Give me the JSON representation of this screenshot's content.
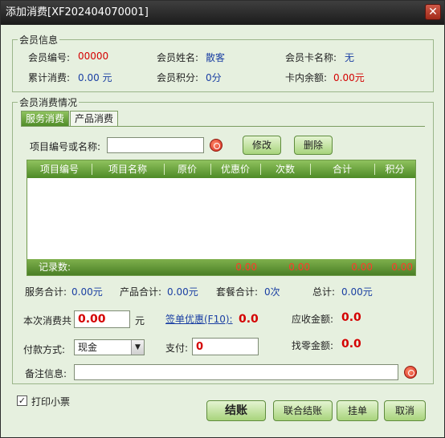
{
  "window": {
    "title": "添加消费[XF202404070001]",
    "close_glyph": "✕"
  },
  "member_info": {
    "title": "会员信息",
    "member_no_label": "会员编号:",
    "member_no_value": "00000",
    "member_name_label": "会员姓名:",
    "member_name_value": "散客",
    "card_name_label": "会员卡名称:",
    "card_name_value": "无",
    "total_spend_label": "累计消费:",
    "total_spend_value": "0.00 元",
    "points_label": "会员积分:",
    "points_value": "0分",
    "balance_label": "卡内余额:",
    "balance_value": "0.00元"
  },
  "consumption": {
    "title": "会员消费情况",
    "tabs": [
      {
        "label": "服务消费"
      },
      {
        "label": "产品消费"
      }
    ],
    "item_search_label": "项目编号或名称:",
    "item_search_value": "",
    "modify_label": "修改",
    "delete_label": "删除",
    "grid": {
      "columns": [
        "项目编号",
        "项目名称",
        "原价",
        "优惠价",
        "次数",
        "合计",
        "积分"
      ],
      "rows": [],
      "footer": {
        "record_count_label": "记录数:",
        "totals": [
          "0.00",
          "0.00",
          "0.00",
          "0.00"
        ]
      }
    }
  },
  "summary": {
    "service_total_label": "服务合计:",
    "service_total_value": "0.00元",
    "product_total_label": "产品合计:",
    "product_total_value": "0.00元",
    "package_total_label": "套餐合计:",
    "package_total_value": "0次",
    "grand_total_label": "总计:",
    "grand_total_value": "0.00元"
  },
  "payment": {
    "this_spend_label": "本次消费共",
    "this_spend_value": "0.00",
    "this_spend_unit": "元",
    "discount_label": "签单优惠(F10):",
    "discount_value": "0.0",
    "receivable_label": "应收金额:",
    "receivable_value": "0.0",
    "method_label": "付款方式:",
    "method_value": "现金",
    "pay_label": "支付:",
    "pay_value": "0",
    "change_label": "找零金额:",
    "change_value": "0.0",
    "remark_label": "备注信息:",
    "remark_value": ""
  },
  "footer": {
    "print_ticket_label": "打印小票",
    "print_ticket_checked": true,
    "checkout_label": "结账",
    "joint_checkout_label": "联合结账",
    "hang_bill_label": "挂单",
    "cancel_label": "取消"
  },
  "colors": {
    "accent_green": "#4d8a26",
    "value_red": "#d40000",
    "value_blue": "#1a3fa3",
    "window_bg": "#e6f0df"
  }
}
